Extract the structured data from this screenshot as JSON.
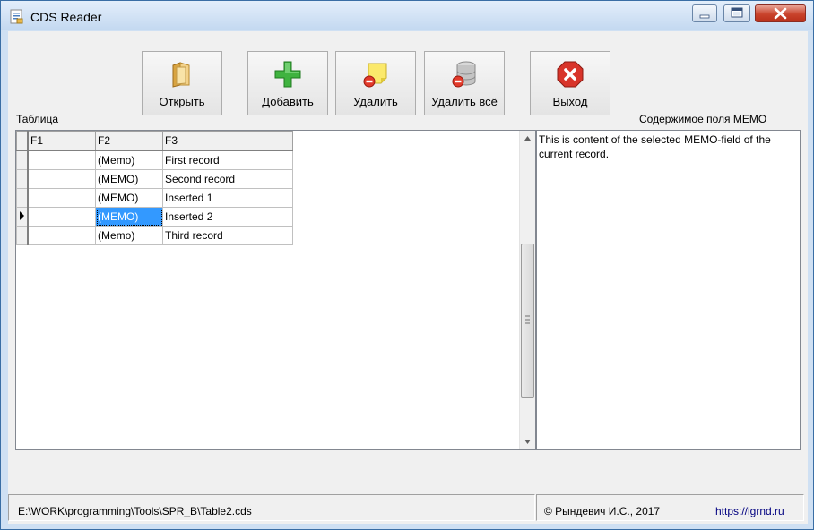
{
  "window": {
    "title": "CDS Reader"
  },
  "toolbar": {
    "open_label": "Открыть",
    "add_label": "Добавить",
    "delete_label": "Удалить",
    "delete_all_label": "Удалить всё",
    "exit_label": "Выход"
  },
  "labels": {
    "table": "Таблица",
    "memo": "Содержимое поля MEMO"
  },
  "grid": {
    "columns": [
      "F1",
      "F2",
      "F3"
    ],
    "rows": [
      {
        "f1": "",
        "f2": "(Memo)",
        "f3": "First record"
      },
      {
        "f1": "",
        "f2": "(MEMO)",
        "f3": "Second record"
      },
      {
        "f1": "",
        "f2": "(MEMO)",
        "f3": "Inserted 1"
      },
      {
        "f1": "",
        "f2": "(MEMO)",
        "f3": "Inserted 2"
      },
      {
        "f1": "",
        "f2": "(Memo)",
        "f3": "Third record"
      }
    ]
  },
  "memo": {
    "text": "This is content of the selected MEMO-field of the current record."
  },
  "status": {
    "path": "E:\\WORK\\programming\\Tools\\SPR_B\\Table2.cds",
    "copyright": "© Рындевич И.С., 2017",
    "link": "https://igrnd.ru"
  },
  "colors": {
    "selection": "#3399ff",
    "link": "#000080",
    "close_button": "#c9432c"
  }
}
